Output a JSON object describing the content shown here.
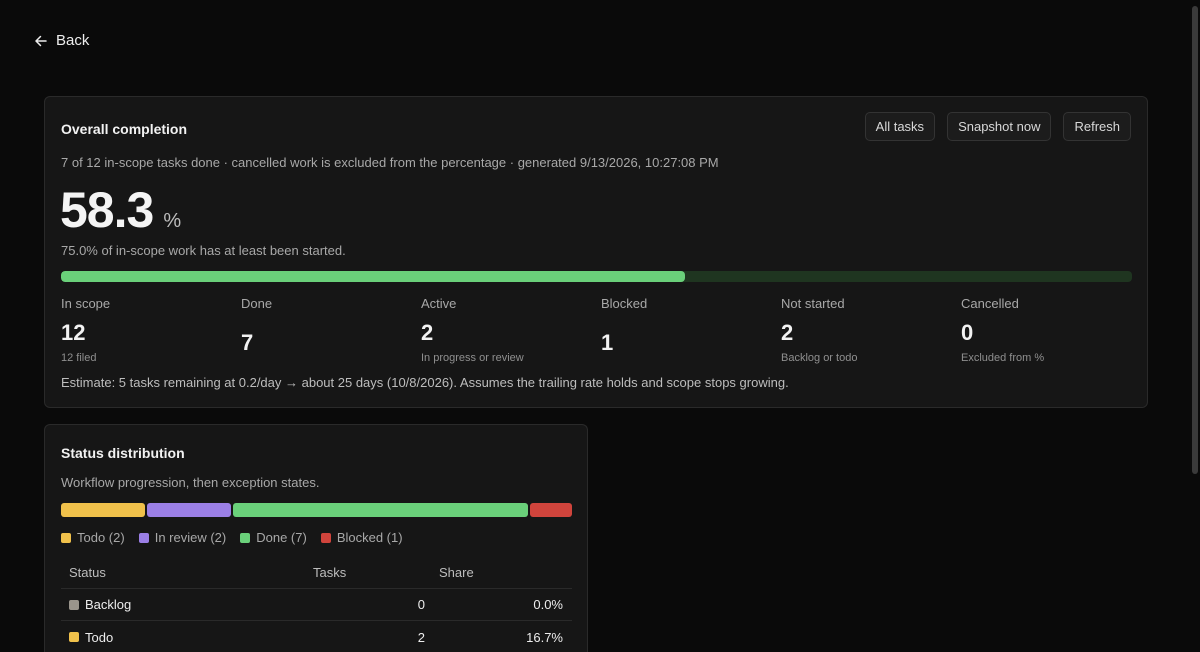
{
  "nav": {
    "back_label": "Back"
  },
  "overall": {
    "title": "Overall completion",
    "actions": {
      "all_tasks": "All tasks",
      "snapshot": "Snapshot now",
      "refresh": "Refresh"
    },
    "subtitle": "7 of 12 in-scope tasks done · cancelled work is excluded from the percentage · generated 9/13/2026, 10:27:08 PM",
    "percent": "58.3",
    "percent_unit": "%",
    "progress_fraction": 0.583,
    "started_note": "75.0% of in-scope work has at least been started.",
    "stats": [
      {
        "label": "In scope",
        "value": "12",
        "note": "12 filed"
      },
      {
        "label": "Done",
        "value": "7",
        "note": ""
      },
      {
        "label": "Active",
        "value": "2",
        "note": "In progress or review"
      },
      {
        "label": "Blocked",
        "value": "1",
        "note": ""
      },
      {
        "label": "Not started",
        "value": "2",
        "note": "Backlog or todo"
      },
      {
        "label": "Cancelled",
        "value": "0",
        "note": "Excluded from %"
      }
    ],
    "estimate": "Estimate: 5 tasks remaining at 0.2/day → about 25 days (10/8/2026). Assumes the trailing rate holds and scope stops growing."
  },
  "status_distribution": {
    "title": "Status distribution",
    "subtitle": "Workflow progression, then exception states.",
    "segments": [
      {
        "name": "Todo",
        "count": 2,
        "color": "#f0c14b"
      },
      {
        "name": "In review",
        "count": 2,
        "color": "#9b7fe6"
      },
      {
        "name": "Done",
        "count": 7,
        "color": "#6ad07a"
      },
      {
        "name": "Blocked",
        "count": 1,
        "color": "#d0443c"
      }
    ],
    "legend": [
      "Todo (2)",
      "In review (2)",
      "Done (7)",
      "Blocked (1)"
    ],
    "table": {
      "headers": {
        "status": "Status",
        "tasks": "Tasks",
        "share": "Share"
      },
      "rows": [
        {
          "status": "Backlog",
          "tasks": "0",
          "share": "0.0%",
          "color": "#9a958c"
        },
        {
          "status": "Todo",
          "tasks": "2",
          "share": "16.7%",
          "color": "#f0c14b"
        }
      ]
    }
  }
}
